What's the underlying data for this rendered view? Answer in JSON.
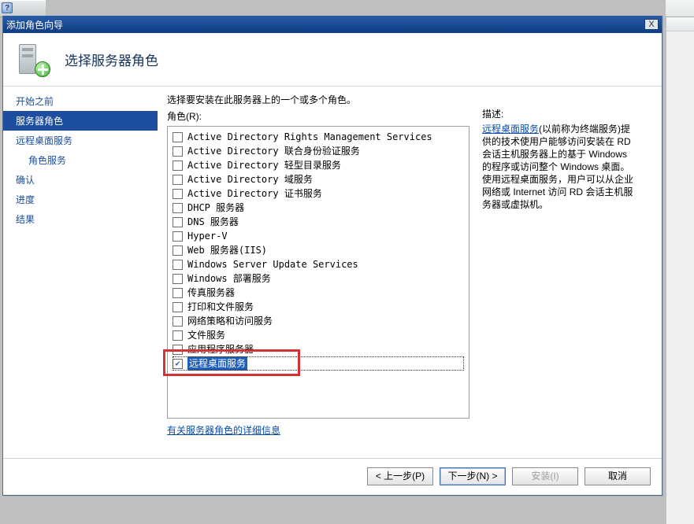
{
  "window": {
    "title": "添加角色向导",
    "close_label": "X"
  },
  "banner": {
    "heading": "选择服务器角色"
  },
  "sidebar": {
    "items": [
      {
        "label": "开始之前",
        "indent": false,
        "selected": false
      },
      {
        "label": "服务器角色",
        "indent": false,
        "selected": true
      },
      {
        "label": "远程桌面服务",
        "indent": false,
        "selected": false
      },
      {
        "label": "角色服务",
        "indent": true,
        "selected": false
      },
      {
        "label": "确认",
        "indent": false,
        "selected": false
      },
      {
        "label": "进度",
        "indent": false,
        "selected": false
      },
      {
        "label": "结果",
        "indent": false,
        "selected": false
      }
    ]
  },
  "content": {
    "instruction": "选择要安装在此服务器上的一个或多个角色。",
    "roles_label": "角色(R):",
    "roles": [
      {
        "label": "Active Directory Rights Management Services",
        "checked": false
      },
      {
        "label": "Active Directory 联合身份验证服务",
        "checked": false
      },
      {
        "label": "Active Directory 轻型目录服务",
        "checked": false
      },
      {
        "label": "Active Directory 域服务",
        "checked": false
      },
      {
        "label": "Active Directory 证书服务",
        "checked": false
      },
      {
        "label": "DHCP 服务器",
        "checked": false
      },
      {
        "label": "DNS 服务器",
        "checked": false
      },
      {
        "label": "Hyper-V",
        "checked": false
      },
      {
        "label": "Web 服务器(IIS)",
        "checked": false
      },
      {
        "label": "Windows Server Update Services",
        "checked": false
      },
      {
        "label": "Windows 部署服务",
        "checked": false
      },
      {
        "label": "传真服务器",
        "checked": false
      },
      {
        "label": "打印和文件服务",
        "checked": false
      },
      {
        "label": "网络策略和访问服务",
        "checked": false
      },
      {
        "label": "文件服务",
        "checked": false
      },
      {
        "label": "应用程序服务器",
        "checked": false
      },
      {
        "label": "远程桌面服务",
        "checked": true
      }
    ],
    "more_info_link": "有关服务器角色的详细信息"
  },
  "description": {
    "title": "描述:",
    "link_text": "远程桌面服务",
    "body": "(以前称为终端服务)提供的技术使用户能够访问安装在 RD 会话主机服务器上的基于 Windows 的程序或访问整个 Windows 桌面。使用远程桌面服务，用户可以从企业网络或 Internet 访问 RD 会话主机服务器或虚拟机。"
  },
  "buttons": {
    "back": "< 上一步(P)",
    "next": "下一步(N) >",
    "install": "安装(I)",
    "cancel": "取消"
  },
  "help_glyph": "?"
}
